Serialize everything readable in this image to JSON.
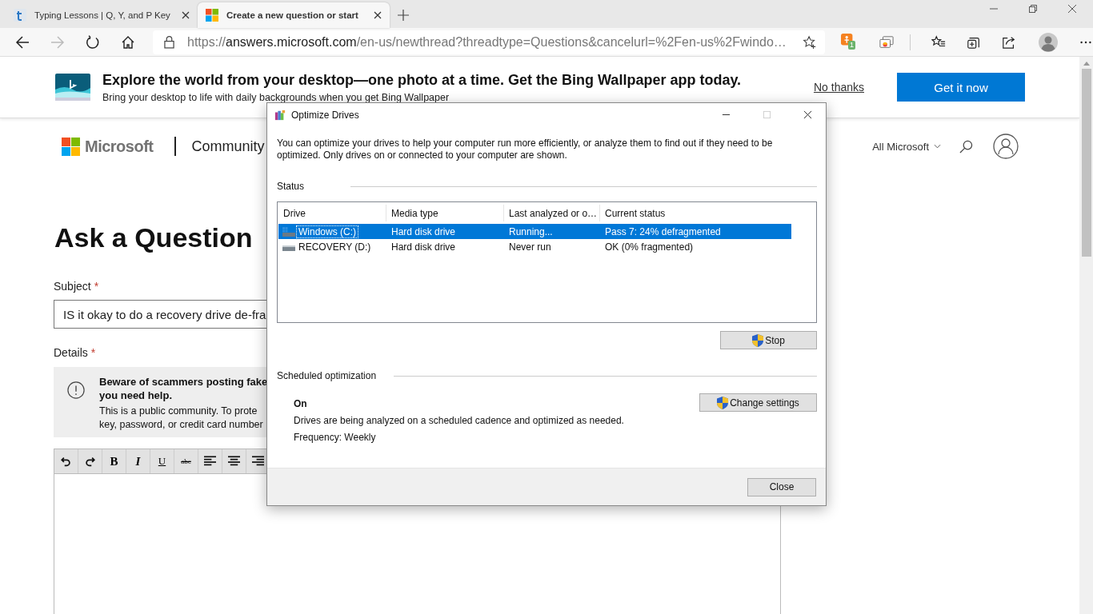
{
  "browser": {
    "tabs": [
      {
        "title": "Typing Lessons | Q, Y, and P Key",
        "kind": "typing",
        "selected": false
      },
      {
        "title": "Create a new question or start",
        "kind": "microsoft",
        "selected": true
      }
    ],
    "url": {
      "scheme": "https://",
      "host": "answers.microsoft.com",
      "path": "/en-us/newthread?threadtype=Questions&cancelurl=%2Fen-us%2Fwindo…"
    },
    "extension_badge": "1"
  },
  "banner": {
    "title": "Explore the world from your desktop—one photo at a time. Get the Bing Wallpaper app today.",
    "subtitle": "Bring your desktop to life with daily backgrounds when you get Bing Wallpaper",
    "dismiss": "No thanks",
    "action": "Get it now"
  },
  "site": {
    "brand": "Microsoft",
    "section": "Community",
    "nav": "All Microsoft"
  },
  "form": {
    "heading": "Ask a Question",
    "subject": {
      "label": "Subject",
      "required": "*",
      "value": "IS it okay to do a recovery drive de-fra"
    },
    "details": {
      "label": "Details",
      "required": "*"
    },
    "notice": {
      "title_lines": [
        "Beware of scammers posting fake",
        "you need help."
      ],
      "body_lines": [
        "This is a public community. To prote",
        "key, password, or credit card number"
      ]
    },
    "toolbar": [
      {
        "kind": "undo"
      },
      {
        "kind": "redo"
      },
      {
        "kind": "bold",
        "label": "B"
      },
      {
        "kind": "italic",
        "label": "I"
      },
      {
        "kind": "underline",
        "label": "U"
      },
      {
        "kind": "strike",
        "label": "abc"
      },
      {
        "kind": "align-left"
      },
      {
        "kind": "align-center"
      },
      {
        "kind": "align-right"
      }
    ]
  },
  "dialog": {
    "title": "Optimize Drives",
    "intro": "You can optimize your drives to help your computer run more efficiently, or analyze them to find out if they need to be optimized. Only drives on or connected to your computer are shown.",
    "status_label": "Status",
    "columns": [
      "Drive",
      "Media type",
      "Last analyzed or o…",
      "Current status"
    ],
    "drives": [
      {
        "name": "Windows (C:)",
        "kind": "system",
        "media": "Hard disk drive",
        "last": "Running...",
        "status": "Pass 7: 24% defragmented",
        "selected": true
      },
      {
        "name": "RECOVERY (D:)",
        "kind": "disk",
        "media": "Hard disk drive",
        "last": "Never run",
        "status": "OK (0% fragmented)",
        "selected": false
      }
    ],
    "stop": "Stop",
    "schedule_label": "Scheduled optimization",
    "schedule_state": "On",
    "schedule_text": "Drives are being analyzed on a scheduled cadence and optimized as needed.",
    "frequency": "Frequency: Weekly",
    "change": "Change settings",
    "close": "Close"
  }
}
